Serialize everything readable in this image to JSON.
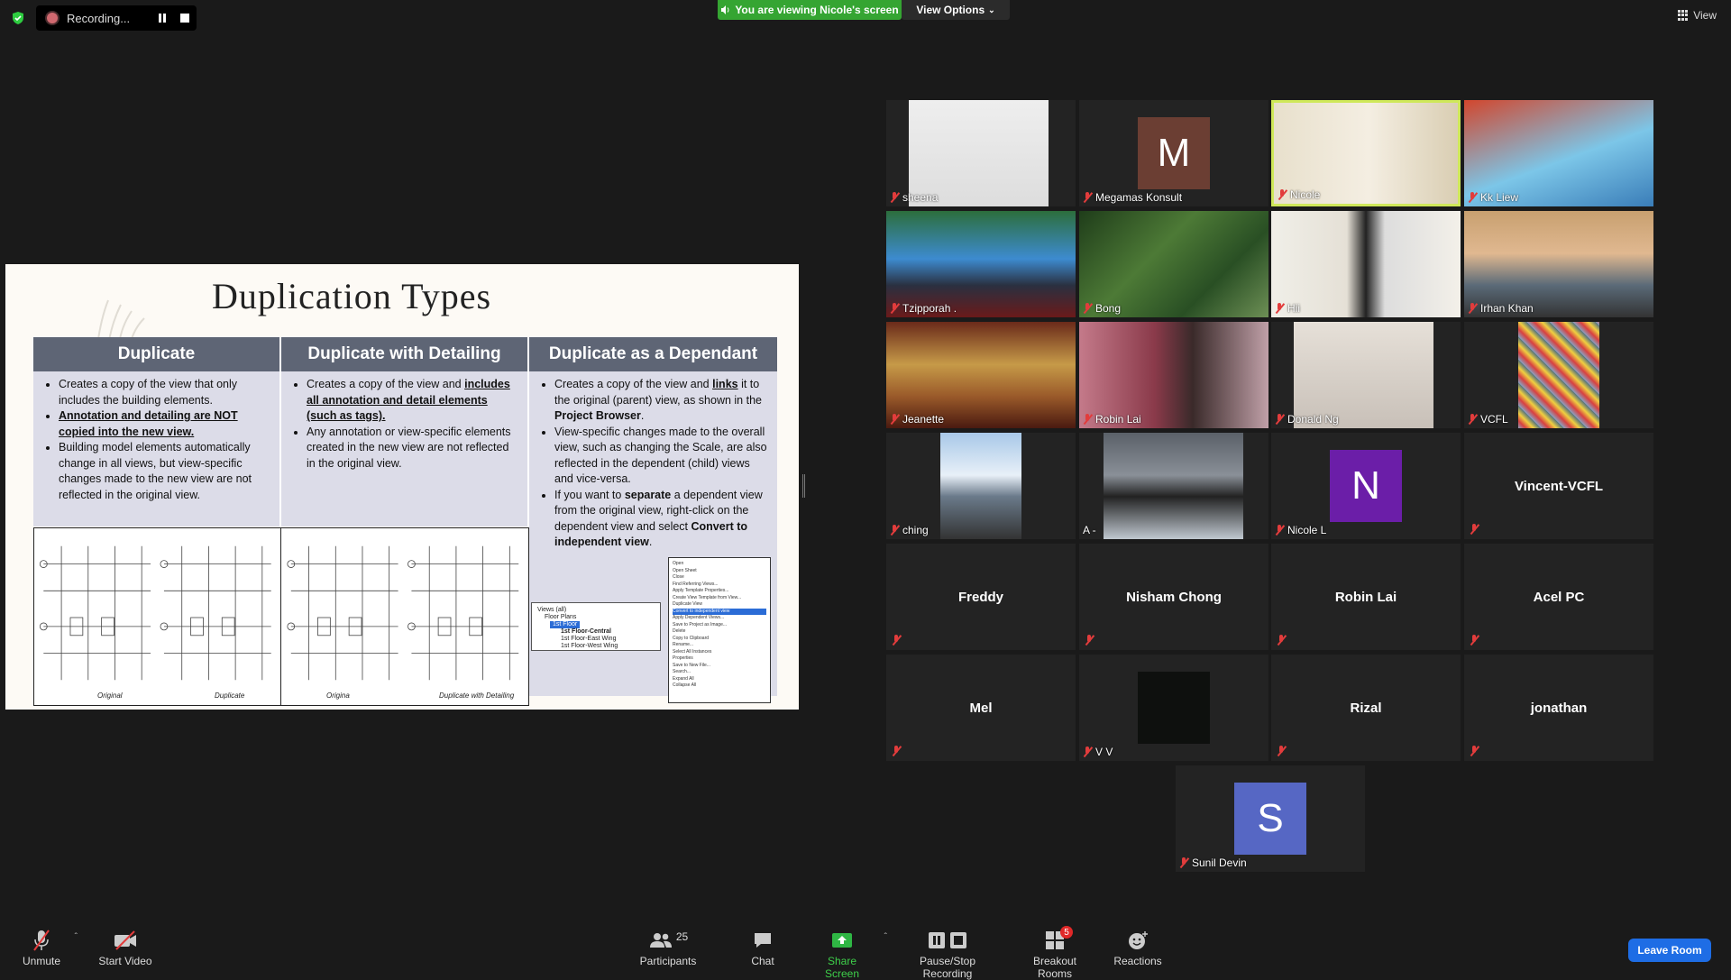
{
  "topbar": {
    "recording_label": "Recording...",
    "viewing_banner": "You are viewing Nicole's screen",
    "view_options": "View Options",
    "view_label": "View"
  },
  "slide": {
    "title": "Duplication Types",
    "columns": [
      {
        "heading": "Duplicate"
      },
      {
        "heading": "Duplicate with Detailing"
      },
      {
        "heading": "Duplicate as a Dependant"
      }
    ],
    "col1": {
      "b1": "Creates a copy of the view that only includes the building elements.",
      "b2": "Annotation and detailing are NOT copied into the new view.",
      "b3": "Building model elements automatically change in all views, but view-specific changes made to the new view are not reflected in the original view."
    },
    "col2": {
      "b1_pre": "Creates a copy of the view and ",
      "b1_strong": "includes all annotation and detail elements (such as tags).",
      "b2": "Any annotation or view-specific elements created in the new view are not reflected in the original view."
    },
    "col3": {
      "b1_pre": "Creates a copy of the view and ",
      "b1_strong": "links",
      "b1_mid": " it to the original (parent) view, as shown in the ",
      "b1_strong2": "Project Browser",
      "b1_end": ".",
      "b2": "View-specific changes made to the overall view, such as changing the Scale, are also reflected in the dependent (child) views and vice-versa.",
      "b3_pre": "If you want to ",
      "b3_strong": "separate",
      "b3_mid": " a dependent view from the original view, right-click on the dependent view and select ",
      "b3_strong2": "Convert to independent view",
      "b3_end": "."
    },
    "drawing_labels": [
      "Original",
      "Duplicate",
      "Origina",
      "Duplicate with Detailing"
    ],
    "browser": {
      "root": "Views (all)",
      "plans": "Floor Plans",
      "sel": "1st Floor",
      "items": [
        "1st Floor-Central",
        "1st Floor-East Wing",
        "1st Floor-West Wing"
      ]
    },
    "menu_items": [
      "Open",
      "Open Sheet",
      "Close",
      "Find Referring Views...",
      "Apply Template Properties...",
      "Create View Template from View...",
      "Duplicate View",
      "Convert to independent view",
      "Apply Dependent Views...",
      "Save to Project as Image...",
      "Delete",
      "Copy to Clipboard",
      "Rename...",
      "Select All Instances",
      "Properties",
      "Save to New File...",
      "Search...",
      "Expand All",
      "Collapse All"
    ]
  },
  "participants": [
    {
      "name": "sheena"
    },
    {
      "name": "Megamas Konsult",
      "initial": "M"
    },
    {
      "name": "Nicole"
    },
    {
      "name": "Kk Liew"
    },
    {
      "name": "Tzipporah ."
    },
    {
      "name": "Bong"
    },
    {
      "name": "Hii"
    },
    {
      "name": "Irhan Khan"
    },
    {
      "name": "Jeanette"
    },
    {
      "name": "Robin Lai"
    },
    {
      "name": "Donald Ng"
    },
    {
      "name": "VCFL"
    },
    {
      "name": "ching"
    },
    {
      "name": "A -"
    },
    {
      "name": "Nicole L",
      "initial": "N"
    },
    {
      "name": "Vincent-VCFL"
    },
    {
      "name": "Freddy"
    },
    {
      "name": "Nisham Chong"
    },
    {
      "name": "Robin Lai"
    },
    {
      "name": "Acel PC"
    },
    {
      "name": "Mel"
    },
    {
      "name": "V V"
    },
    {
      "name": "Rizal"
    },
    {
      "name": "jonathan"
    },
    {
      "name": "Sunil Devin",
      "initial": "S"
    }
  ],
  "toolbar": {
    "unmute": "Unmute",
    "start_video": "Start Video",
    "participants": "Participants",
    "participants_count": "25",
    "chat": "Chat",
    "share_screen": "Share Screen",
    "pause_stop": "Pause/Stop Recording",
    "breakout": "Breakout Rooms",
    "breakout_badge": "5",
    "reactions": "Reactions",
    "leave": "Leave Room"
  },
  "colors": {
    "accent_green": "#35a532",
    "leave_blue": "#1e6de5",
    "active_speaker": "#cfe85a",
    "muted_red": "#e23c3c"
  }
}
